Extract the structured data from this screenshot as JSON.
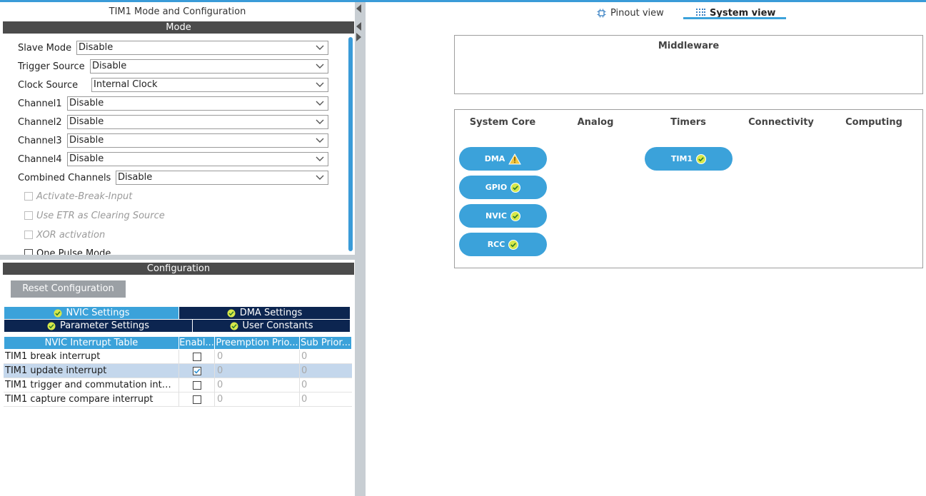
{
  "left_panel": {
    "title": "TIM1 Mode and Configuration",
    "mode_header": "Mode",
    "mode_fields": [
      {
        "label": "Slave Mode",
        "value": "Disable"
      },
      {
        "label": "Trigger Source",
        "value": "Disable"
      },
      {
        "label": "Clock Source",
        "value": "Internal Clock"
      },
      {
        "label": "Channel1",
        "value": "Disable"
      },
      {
        "label": "Channel2",
        "value": "Disable"
      },
      {
        "label": "Channel3",
        "value": "Disable"
      },
      {
        "label": "Channel4",
        "value": "Disable"
      },
      {
        "label": "Combined Channels",
        "value": "Disable"
      }
    ],
    "mode_checkboxes": [
      {
        "label": "Activate-Break-Input",
        "enabled": false,
        "checked": false
      },
      {
        "label": "Use ETR as Clearing Source",
        "enabled": false,
        "checked": false
      },
      {
        "label": "XOR activation",
        "enabled": false,
        "checked": false
      },
      {
        "label": "One Pulse Mode",
        "enabled": true,
        "checked": false
      }
    ],
    "config_header": "Configuration",
    "reset_button": "Reset Configuration",
    "tabs": [
      {
        "label": "NVIC Settings",
        "active": true
      },
      {
        "label": "DMA Settings",
        "active": false
      },
      {
        "label": "Parameter Settings",
        "active": false
      },
      {
        "label": "User Constants",
        "active": false
      }
    ],
    "nvic_table": {
      "headers": [
        "NVIC Interrupt Table",
        "Enabl...",
        "Preemption Prio...",
        "Sub Prior..."
      ],
      "rows": [
        {
          "name": "TIM1 break interrupt",
          "enabled": false,
          "preemption": "0",
          "sub": "0"
        },
        {
          "name": "TIM1 update interrupt",
          "enabled": true,
          "preemption": "0",
          "sub": "0"
        },
        {
          "name": "TIM1 trigger and commutation inte...",
          "enabled": false,
          "preemption": "0",
          "sub": "0"
        },
        {
          "name": "TIM1 capture compare interrupt",
          "enabled": false,
          "preemption": "0",
          "sub": "0"
        }
      ]
    }
  },
  "right_panel": {
    "view_tabs": [
      {
        "label": "Pinout view",
        "icon": "chip-icon",
        "active": false
      },
      {
        "label": "System view",
        "icon": "grid-icon",
        "active": true
      }
    ],
    "middleware_title": "Middleware",
    "categories": [
      "System Core",
      "Analog",
      "Timers",
      "Connectivity",
      "Computing"
    ],
    "system_core_items": [
      {
        "label": "DMA",
        "status": "warning"
      },
      {
        "label": "GPIO",
        "status": "ok"
      },
      {
        "label": "NVIC",
        "status": "ok"
      },
      {
        "label": "RCC",
        "status": "ok"
      }
    ],
    "timers_items": [
      {
        "label": "TIM1",
        "status": "ok"
      }
    ]
  },
  "colors": {
    "accent": "#3ba2da",
    "tab_dark": "#0c2550",
    "header_bar": "#4b4b4b",
    "ok_icon": "#d7e84a",
    "warning_icon": "#f2c53d"
  }
}
